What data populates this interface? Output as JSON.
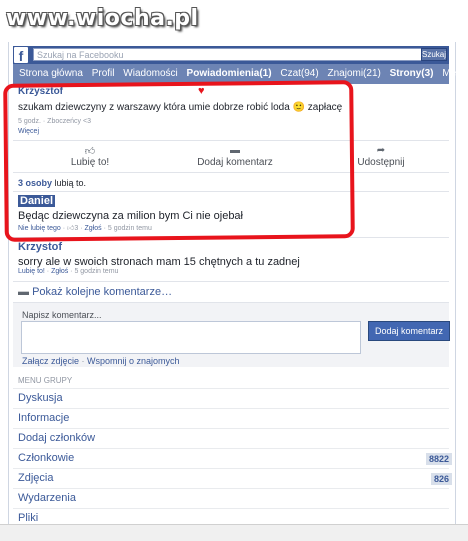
{
  "watermark": "www.wiocha.pl",
  "topbar": {
    "logo": "f",
    "search_placeholder": "Szukaj na Facebooku",
    "search_button": "Szukaj"
  },
  "nav": {
    "items": [
      "Strona główna",
      "Profil",
      "Wiadomości",
      "Powiadomienia(1)",
      "Czat(94)",
      "Znajomi(21)",
      "Strony(3)",
      "Menu"
    ]
  },
  "post": {
    "author": "Krzysztof",
    "text": "szukam dziewczyny z warszawy która umie dobrze robić loda 🙂 zapłacę",
    "meta": "5 godz. · Zboczeńcy <3",
    "more": "Więcej",
    "like_label": "Lubię to!",
    "comment_label": "Dodaj komentarz",
    "share_label": "Udostępnij",
    "likes_count": "3 osoby",
    "likes_suffix": " lubią to."
  },
  "comments": [
    {
      "author": "Daniel",
      "text": "Będąc dziewczyna za milion bym Ci nie ojebał",
      "like": "Nie lubię tego",
      "likes": "3",
      "report": "Zgłoś",
      "time": "5 godzin temu"
    },
    {
      "author": "Krzystof",
      "text": "sorry ale w swoich stronach mam 15 chętnych a tu zadnej",
      "like": "Lubię to!",
      "report": "Zgłoś",
      "time": "5 godzin temu"
    }
  ],
  "more_comments": "Pokaż kolejne komentarze…",
  "comment_box": {
    "label": "Napisz komentarz...",
    "submit": "Dodaj komentarz",
    "attach_photo": "Załącz zdjęcie",
    "mention": "Wspomnij o znajomych"
  },
  "group_menu": {
    "title": "MENU GRUPY",
    "items": [
      "Dyskusja",
      "Informacje",
      "Dodaj członków",
      "Członkowie",
      "Zdjęcia",
      "Wydarzenia",
      "Pliki"
    ],
    "members_count": "8822",
    "photos_count": "826"
  }
}
